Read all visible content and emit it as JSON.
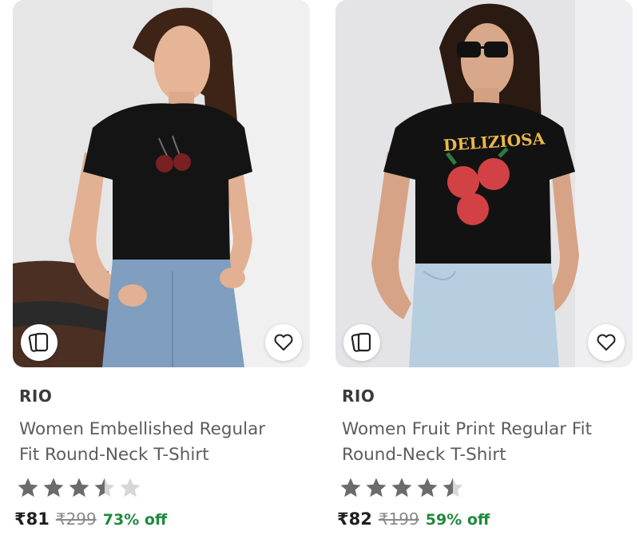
{
  "products": [
    {
      "brand": "RIO",
      "title_line1": "Women Embellished Regular",
      "title_line2": "Fit Round-Neck T-Shirt",
      "rating": 3.5,
      "price": "₹81",
      "mrp": "₹299",
      "discount": "73% off",
      "look_icon": "similar-products-icon",
      "wishlist_icon": "heart-icon"
    },
    {
      "brand": "RIO",
      "title_line1": "Women Fruit Print Regular Fit",
      "title_line2": "Round-Neck T-Shirt",
      "rating": 4.5,
      "price": "₹82",
      "mrp": "₹199",
      "discount": "59% off",
      "look_icon": "similar-products-icon",
      "wishlist_icon": "heart-icon",
      "print_text": "DELIZIOSA"
    }
  ],
  "colors": {
    "discount": "#1f8a3c",
    "star_filled": "#6b6b6b",
    "star_empty": "#d6d6d6",
    "title": "#5c5c5c"
  }
}
